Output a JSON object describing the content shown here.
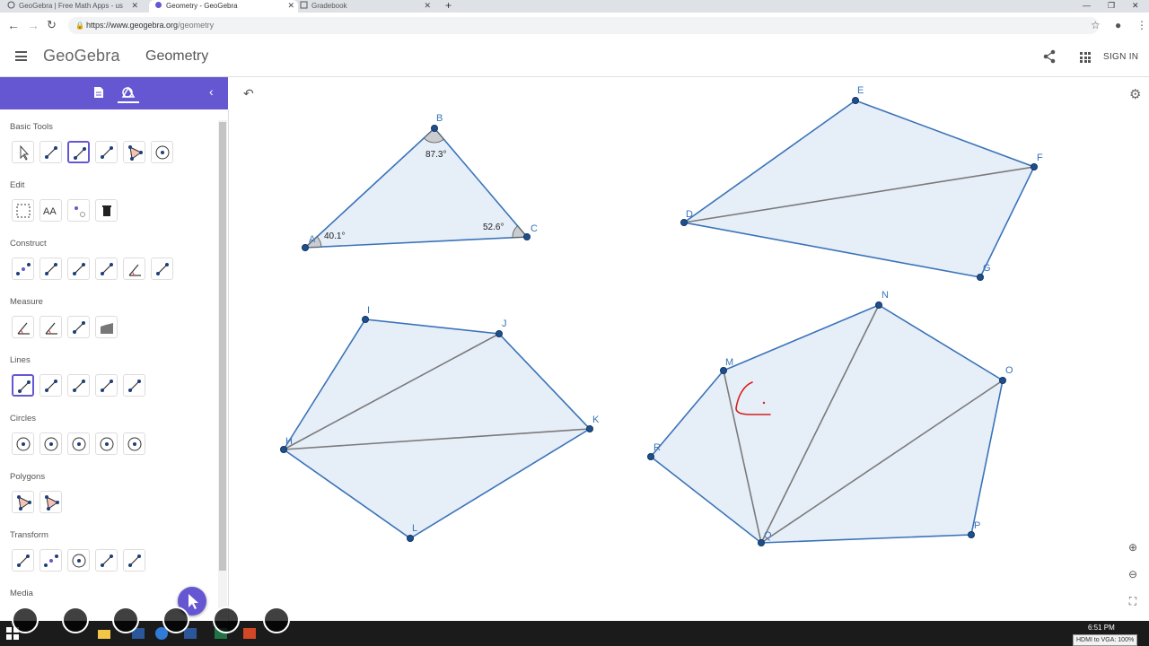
{
  "browser": {
    "tabs": [
      {
        "label": "GeoGebra | Free Math Apps - us",
        "active": false
      },
      {
        "label": "Geometry - GeoGebra",
        "active": true
      },
      {
        "label": "Gradebook",
        "active": false
      }
    ],
    "url_main": "https://www.geogebra.org",
    "url_path": "/geometry"
  },
  "header": {
    "logo": "GeoGebra",
    "title": "Geometry",
    "signin": "SIGN IN"
  },
  "panel": {
    "sections": [
      {
        "title": "Basic Tools",
        "tools": [
          "move-tool",
          "point-tool",
          "segment-tool",
          "line-tool",
          "polygon-tool",
          "circle-center-point-tool"
        ]
      },
      {
        "title": "Edit",
        "tools": [
          "select-objects-tool",
          "text-tool",
          "show-hide-object-tool",
          "delete-tool"
        ]
      },
      {
        "title": "Construct",
        "tools": [
          "midpoint-tool",
          "perpendicular-line-tool",
          "perpendicular-bisector-tool",
          "parallel-line-tool",
          "angle-bisector-tool",
          "tangents-tool"
        ]
      },
      {
        "title": "Measure",
        "tools": [
          "angle-tool",
          "angle-given-size-tool",
          "distance-tool",
          "area-tool"
        ]
      },
      {
        "title": "Lines",
        "tools": [
          "segment-tool",
          "segment-fixed-length-tool",
          "line-tool",
          "ray-tool",
          "vector-tool"
        ]
      },
      {
        "title": "Circles",
        "tools": [
          "circle-center-point-tool",
          "circle-center-radius-tool",
          "compass-tool",
          "semicircle-tool",
          "circle-three-points-tool"
        ]
      },
      {
        "title": "Polygons",
        "tools": [
          "polygon-tool",
          "regular-polygon-tool"
        ]
      },
      {
        "title": "Transform",
        "tools": [
          "reflect-line-tool",
          "reflect-point-tool",
          "reflect-circle-tool",
          "translate-vector-tool",
          "rotate-tool"
        ]
      },
      {
        "title": "Media",
        "tools": []
      }
    ]
  },
  "canvas": {
    "points": [
      "A",
      "B",
      "C",
      "D",
      "E",
      "F",
      "G",
      "H",
      "I",
      "J",
      "K",
      "L",
      "M",
      "N",
      "O",
      "P",
      "Q",
      "R"
    ],
    "angles": [
      "40.1°",
      "87.3°",
      "52.6°"
    ]
  },
  "taskbar": {
    "time": "6:51 PM",
    "hdmi": "HDMI to VGA: 100%"
  },
  "colors": {
    "accent": "#6557d2",
    "polygon_fill": "#e6eef8",
    "polygon_stroke": "#3a73b8",
    "point": "#1c4f8c",
    "diagonal": "#7a7a7a",
    "annotation": "#d62020"
  }
}
